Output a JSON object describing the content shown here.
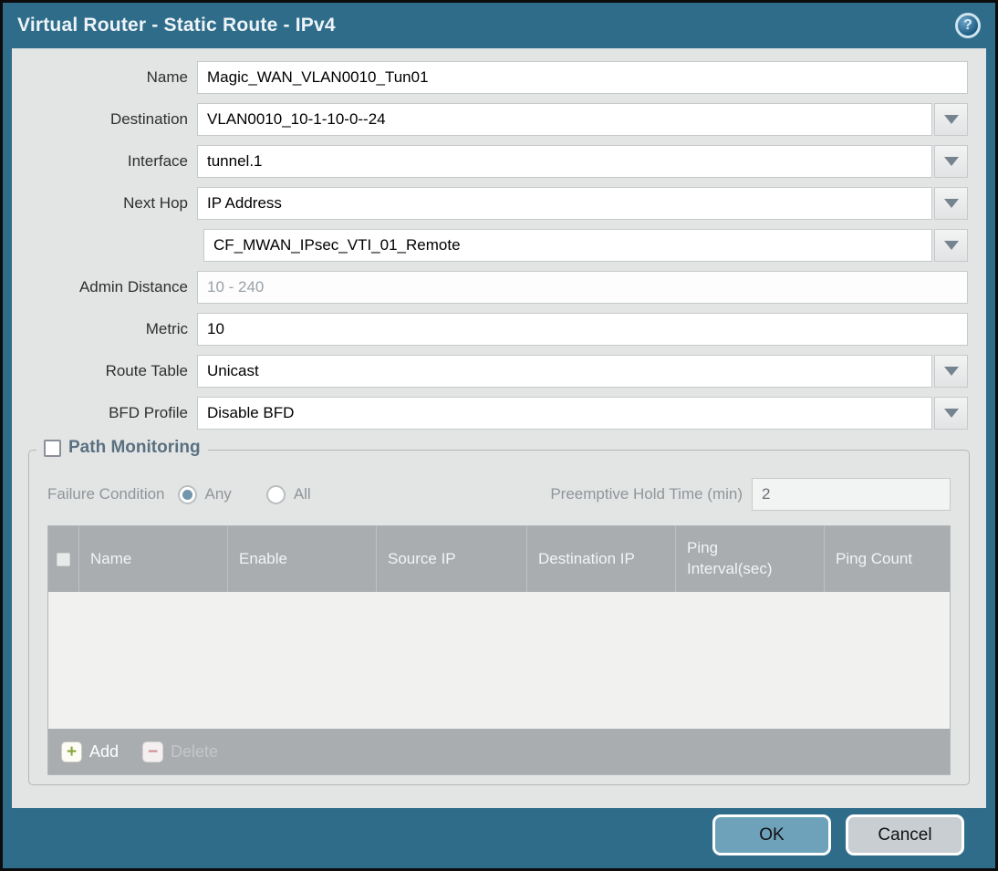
{
  "title": "Virtual Router - Static Route - IPv4",
  "help_icon": "?",
  "form": {
    "name": {
      "label": "Name",
      "value": "Magic_WAN_VLAN0010_Tun01"
    },
    "destination": {
      "label": "Destination",
      "value": "VLAN0010_10-1-10-0--24"
    },
    "interface": {
      "label": "Interface",
      "value": "tunnel.1"
    },
    "next_hop": {
      "label": "Next Hop",
      "type_value": "IP Address",
      "address_value": "CF_MWAN_IPsec_VTI_01_Remote"
    },
    "admin_distance": {
      "label": "Admin Distance",
      "placeholder": "10 - 240",
      "value": ""
    },
    "metric": {
      "label": "Metric",
      "value": "10"
    },
    "route_table": {
      "label": "Route Table",
      "value": "Unicast"
    },
    "bfd_profile": {
      "label": "BFD Profile",
      "value": "Disable BFD"
    }
  },
  "path_monitoring": {
    "legend": "Path Monitoring",
    "enabled": false,
    "failure_condition": {
      "label": "Failure Condition",
      "options": [
        "Any",
        "All"
      ],
      "selected": "Any"
    },
    "preemptive_hold": {
      "label": "Preemptive Hold Time (min)",
      "value": "2"
    },
    "table": {
      "columns": [
        "Name",
        "Enable",
        "Source IP",
        "Destination IP",
        "Ping Interval(sec)",
        "Ping Count"
      ],
      "rows": []
    },
    "toolbar": {
      "add": "Add",
      "delete": "Delete"
    }
  },
  "footer": {
    "ok": "OK",
    "cancel": "Cancel"
  },
  "colors": {
    "frame_teal": "#2e6c8a",
    "panel_gray": "#e3e5e5",
    "table_header_gray": "#a9adb0",
    "legend_blue_gray": "#5a7080",
    "ok_button": "#6ea2ba",
    "cancel_button": "#c9ced2",
    "radio_selected": "#7195ac",
    "add_plus_green": "#88a63e",
    "delete_minus_red": "#cc8d92"
  }
}
